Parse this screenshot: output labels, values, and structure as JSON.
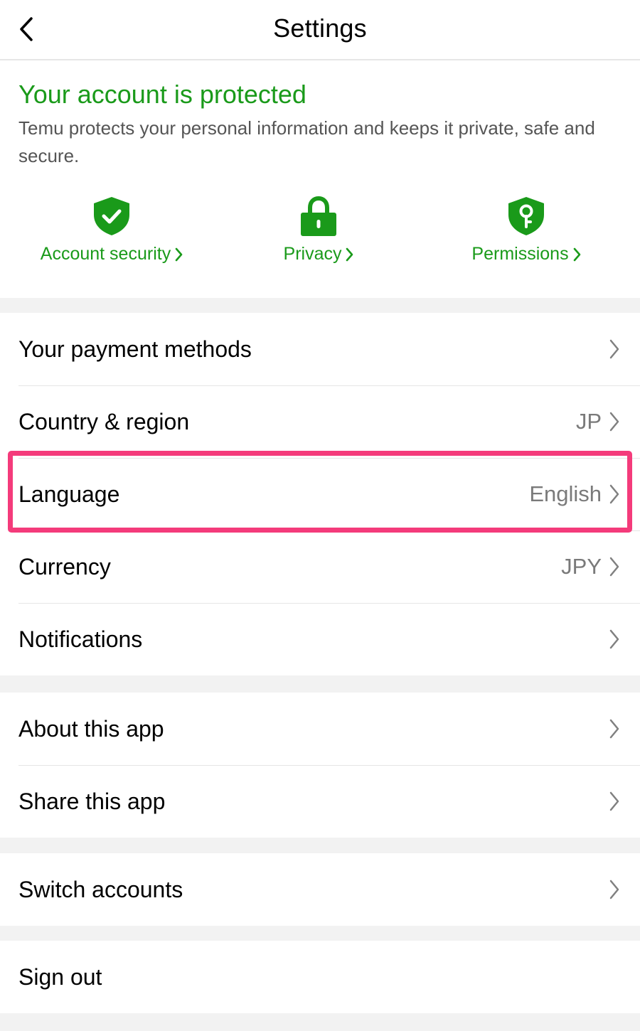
{
  "header": {
    "title": "Settings",
    "back_icon": "chevron-left-icon"
  },
  "protection": {
    "title": "Your account is protected",
    "description": "Temu protects your personal information and keeps it private, safe and secure.",
    "features": [
      {
        "label": "Account security",
        "icon": "shield-check-icon"
      },
      {
        "label": "Privacy",
        "icon": "lock-icon"
      },
      {
        "label": "Permissions",
        "icon": "shield-key-icon"
      }
    ]
  },
  "groups": {
    "preferences": [
      {
        "label": "Your payment methods",
        "value": ""
      },
      {
        "label": "Country & region",
        "value": "JP"
      },
      {
        "label": "Language",
        "value": "English"
      },
      {
        "label": "Currency",
        "value": "JPY"
      },
      {
        "label": "Notifications",
        "value": ""
      }
    ],
    "app": [
      {
        "label": "About this app"
      },
      {
        "label": "Share this app"
      }
    ],
    "account": [
      {
        "label": "Switch accounts"
      }
    ],
    "signout": [
      {
        "label": "Sign out"
      }
    ]
  },
  "colors": {
    "brand_green": "#1a9a1a",
    "highlight": "#f43b7b",
    "secondary_text": "#7a7a7a",
    "background": "#f2f2f2"
  }
}
